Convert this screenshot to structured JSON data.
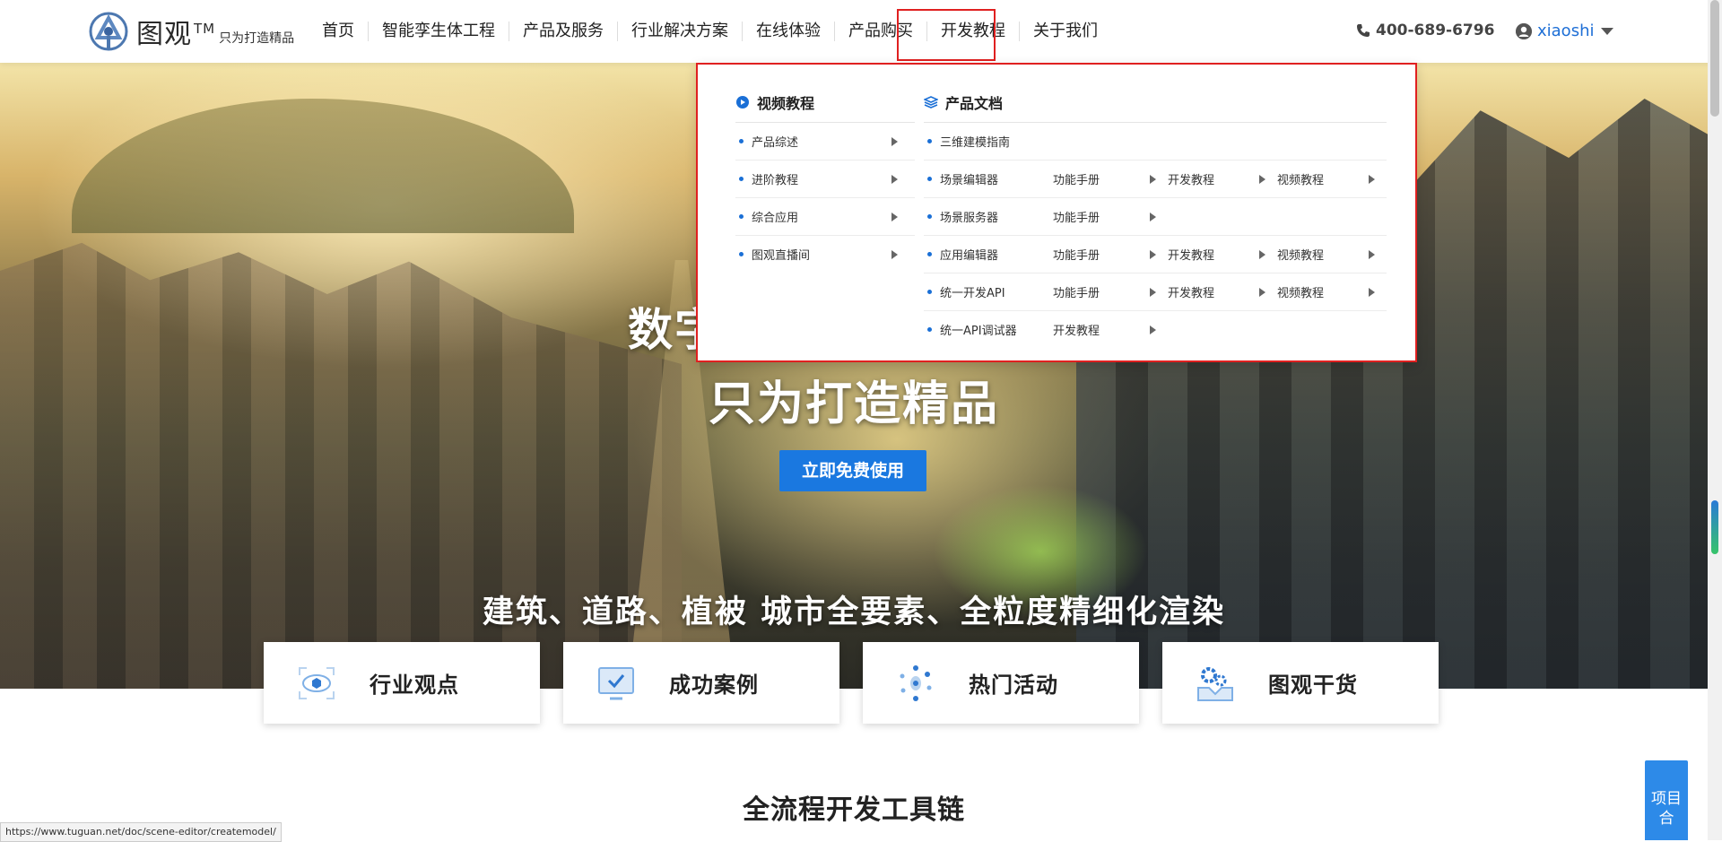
{
  "logo": {
    "name": "图观",
    "tm": "TM",
    "slogan": "只为打造精品"
  },
  "nav": [
    {
      "label": "首页"
    },
    {
      "label": "智能孪生体工程"
    },
    {
      "label": "产品及服务"
    },
    {
      "label": "行业解决方案"
    },
    {
      "label": "在线体验"
    },
    {
      "label": "产品购买"
    },
    {
      "label": "开发教程"
    },
    {
      "label": "关于我们"
    }
  ],
  "header": {
    "phone": "400-689-6796",
    "username": "xiaoshi"
  },
  "dropdown": {
    "video": {
      "title": "视频教程",
      "items": [
        "产品综述",
        "进阶教程",
        "综合应用",
        "图观直播间"
      ]
    },
    "docs": {
      "title": "产品文档",
      "rows": [
        {
          "name": "三维建模指南",
          "links": []
        },
        {
          "name": "场景编辑器",
          "links": [
            "功能手册",
            "开发教程",
            "视频教程"
          ]
        },
        {
          "name": "场景服务器",
          "links": [
            "功能手册"
          ]
        },
        {
          "name": "应用编辑器",
          "links": [
            "功能手册",
            "开发教程",
            "视频教程"
          ]
        },
        {
          "name": "统一开发API",
          "links": [
            "功能手册",
            "开发教程",
            "视频教程"
          ]
        },
        {
          "name": "统一API调试器",
          "links": [
            "开发教程"
          ]
        }
      ]
    }
  },
  "hero": {
    "title_line1": "数字",
    "title_line2": "只为打造精品",
    "cta": "立即免费使用",
    "subtitle": "建筑、道路、植被  城市全要素、全粒度精细化渲染"
  },
  "cards": [
    {
      "label": "行业观点",
      "icon": "cube-eye-icon"
    },
    {
      "label": "成功案例",
      "icon": "monitor-check-icon"
    },
    {
      "label": "热门活动",
      "icon": "dots-ring-icon"
    },
    {
      "label": "图观干货",
      "icon": "gears-tray-icon"
    }
  ],
  "section": {
    "title": "全流程开发工具链"
  },
  "side_tab": {
    "label": "项目合"
  },
  "status_url": "https://www.tuguan.net/doc/scene-editor/createmodel/",
  "colors": {
    "accent": "#1a78e0",
    "highlight_border": "#e02020",
    "bullet": "#1a6fd6"
  }
}
